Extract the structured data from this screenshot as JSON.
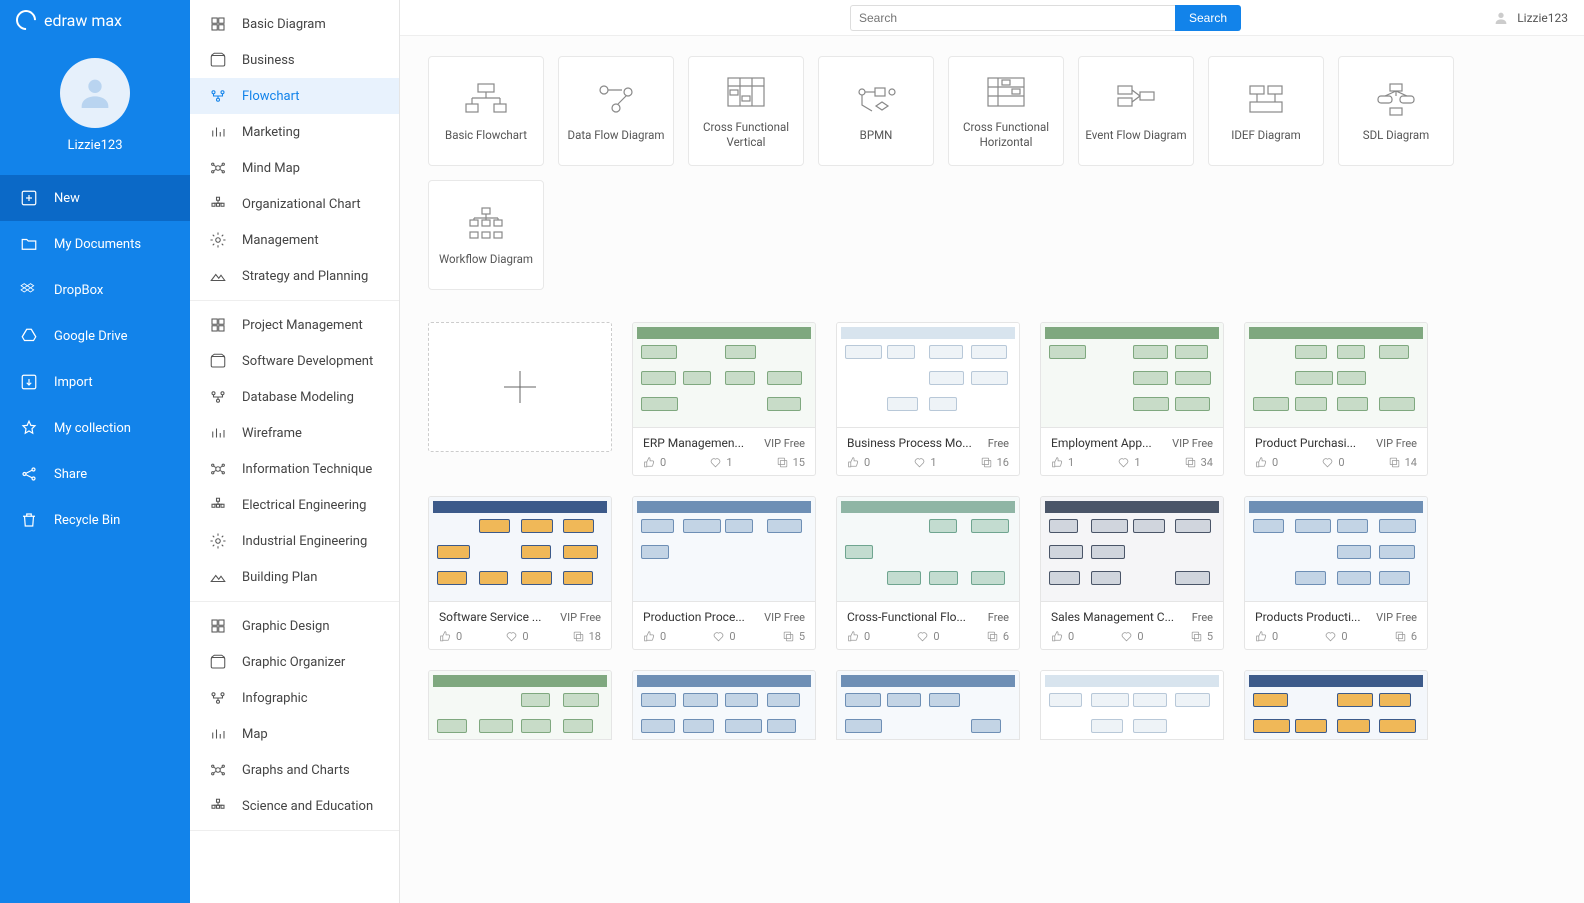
{
  "app": {
    "name": "edraw max"
  },
  "profile": {
    "username": "Lizzie123"
  },
  "sidebar": {
    "items": [
      {
        "label": "New",
        "icon": "plus-square",
        "active": true
      },
      {
        "label": "My Documents",
        "icon": "folder"
      },
      {
        "label": "DropBox",
        "icon": "dropbox"
      },
      {
        "label": "Google Drive",
        "icon": "gdrive"
      },
      {
        "label": "Import",
        "icon": "import"
      },
      {
        "label": "My collection",
        "icon": "star"
      },
      {
        "label": "Share",
        "icon": "share"
      },
      {
        "label": "Recycle Bin",
        "icon": "trash"
      }
    ]
  },
  "categories": {
    "groups": [
      [
        "Basic Diagram",
        "Business",
        "Flowchart",
        "Marketing",
        "Mind Map",
        "Organizational Chart",
        "Management",
        "Strategy and Planning"
      ],
      [
        "Project Management",
        "Software Development",
        "Database Modeling",
        "Wireframe",
        "Information Technique",
        "Electrical Engineering",
        "Industrial Engineering",
        "Building Plan"
      ],
      [
        "Graphic Design",
        "Graphic Organizer",
        "Infographic",
        "Map",
        "Graphs and Charts",
        "Science and Education"
      ]
    ],
    "selected": "Flowchart"
  },
  "search": {
    "placeholder": "Search",
    "button": "Search"
  },
  "user": {
    "name": "Lizzie123"
  },
  "types": [
    "Basic Flowchart",
    "Data Flow Diagram",
    "Cross Functional Vertical",
    "BPMN",
    "Cross Functional Horizontal",
    "Event Flow Diagram",
    "IDEF Diagram",
    "SDL Diagram",
    "Workflow Diagram"
  ],
  "templates": [
    {
      "title": "ERP Managemen...",
      "badge": "VIP Free",
      "likes": 0,
      "favs": 1,
      "copies": 15,
      "theme": "green"
    },
    {
      "title": "Business Process Mo...",
      "badge": "Free",
      "likes": 0,
      "favs": 1,
      "copies": 16,
      "theme": "light"
    },
    {
      "title": "Employment App...",
      "badge": "VIP Free",
      "likes": 1,
      "favs": 1,
      "copies": 34,
      "theme": "green"
    },
    {
      "title": "Product Purchasi...",
      "badge": "VIP Free",
      "likes": 0,
      "favs": 0,
      "copies": 14,
      "theme": "green"
    },
    {
      "title": "Software Service ...",
      "badge": "VIP Free",
      "likes": 0,
      "favs": 0,
      "copies": 18,
      "theme": "blue"
    },
    {
      "title": "Production Proce...",
      "badge": "VIP Free",
      "likes": 0,
      "favs": 0,
      "copies": 5,
      "theme": "blue2"
    },
    {
      "title": "Cross-Functional Flo...",
      "badge": "Free",
      "likes": 0,
      "favs": 0,
      "copies": 6,
      "theme": "teal"
    },
    {
      "title": "Sales Management C...",
      "badge": "Free",
      "likes": 0,
      "favs": 0,
      "copies": 5,
      "theme": "dark"
    },
    {
      "title": "Products Producti...",
      "badge": "VIP Free",
      "likes": 0,
      "favs": 0,
      "copies": 6,
      "theme": "blue2"
    }
  ]
}
